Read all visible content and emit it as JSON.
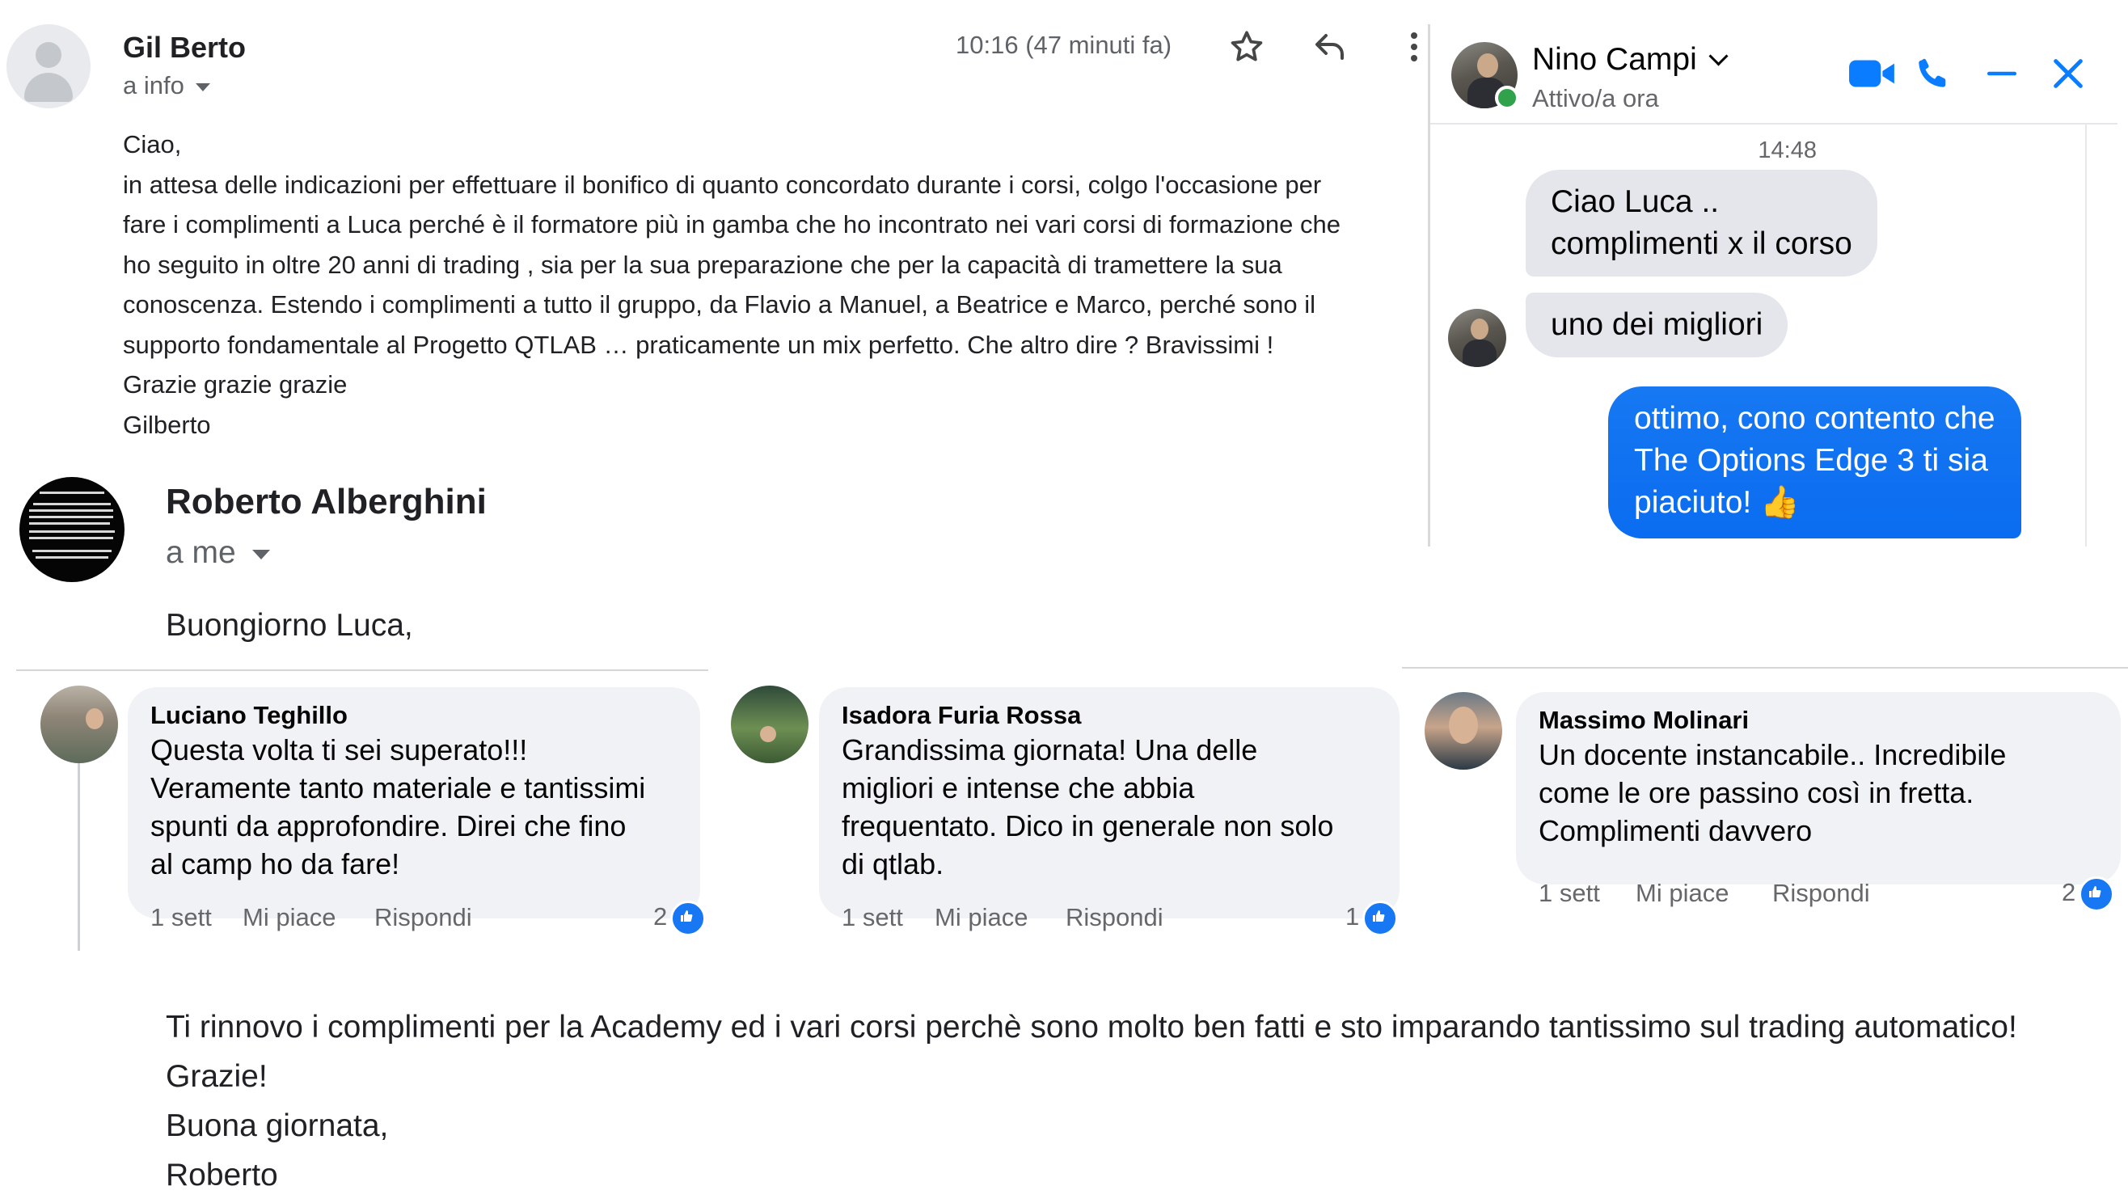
{
  "email1": {
    "sender": "Gil Berto",
    "recipient": "a info",
    "time": "10:16 (47 minuti fa)",
    "body_lines": [
      "Ciao,",
      "in attesa delle indicazioni per effettuare il bonifico di quanto concordato durante i corsi, colgo l'occasione per",
      "fare i complimenti a Luca perché è il formatore più in gamba che ho incontrato nei vari corsi di formazione che",
      "ho seguito in oltre 20 anni di trading , sia per la sua preparazione che per la capacità di tramettere la sua",
      "conoscenza. Estendo i complimenti a tutto il gruppo, da Flavio a Manuel, a Beatrice e Marco, perché sono il",
      "supporto fondamentale al Progetto QTLAB … praticamente un mix perfetto. Che altro dire ? Bravissimi !",
      "Grazie grazie grazie",
      "Gilberto"
    ]
  },
  "email2": {
    "sender": "Roberto Alberghini",
    "recipient": "a me",
    "greeting": "Buongiorno Luca,",
    "closing_lines": [
      "Ti rinnovo i complimenti per la Academy ed i vari corsi perchè sono molto ben fatti e sto imparando tantissimo sul trading automatico!",
      "Grazie!",
      "Buona giornata,",
      "Roberto"
    ]
  },
  "messenger": {
    "contact_name": "Nino Campi",
    "status": "Attivo/a ora",
    "timestamp": "14:48",
    "incoming": [
      [
        "Ciao Luca ..",
        "complimenti x il corso"
      ],
      [
        "uno dei migliori"
      ]
    ],
    "outgoing": [
      "ottimo, cono contento che",
      "The Options Edge 3 ti sia",
      "piaciuto! 👍"
    ]
  },
  "comments": [
    {
      "author": "Luciano Teghillo",
      "lines": [
        "Questa volta ti sei superato!!!",
        "Veramente tanto materiale e tantissimi",
        "spunti da approfondire. Direi che fino",
        "al camp ho da fare!"
      ],
      "age": "1 sett",
      "like": "Mi piace",
      "reply": "Rispondi",
      "likes": "2"
    },
    {
      "author": "Isadora Furia Rossa",
      "lines": [
        "Grandissima giornata! Una delle",
        "migliori e intense che abbia",
        "frequentato. Dico in generale non solo",
        "di qtlab."
      ],
      "age": "1 sett",
      "like": "Mi piace",
      "reply": "Rispondi",
      "likes": "1"
    },
    {
      "author": "Massimo Molinari",
      "lines": [
        "Un docente instancabile.. Incredibile",
        "come le ore passino così in fretta.",
        "Complimenti davvero"
      ],
      "age": "1 sett",
      "like": "Mi piace",
      "reply": "Rispondi",
      "likes": "2"
    }
  ],
  "colors": {
    "messenger_blue": "#0a7cff",
    "facebook_blue": "#1877f2",
    "bubble_gray": "#e4e6eb",
    "comment_gray": "#f0f2f5",
    "online_green": "#31a24c"
  }
}
